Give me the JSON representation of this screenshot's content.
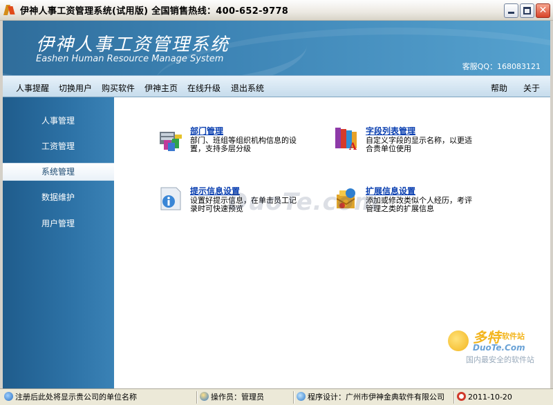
{
  "window": {
    "title": "伊神人事工资管理系统(试用版) 全国销售热线：400-652-9778"
  },
  "banner": {
    "title": "伊神人事工资管理系统",
    "subtitle": "Eashen Human Resource Manage System",
    "qq": "客服QQ：168083121"
  },
  "menu": {
    "items": [
      "人事提醒",
      "切换用户",
      "购买软件",
      "伊神主页",
      "在线升级",
      "退出系统"
    ],
    "help": "帮助",
    "about": "关于"
  },
  "sidebar": {
    "items": [
      "人事管理",
      "工资管理",
      "系统管理",
      "数据维护",
      "用户管理"
    ],
    "active_index": 2
  },
  "modules": [
    {
      "title": "部门管理",
      "desc": "部门、班组等组织机构信息的设置，支持多层分级",
      "icon": "department-icon"
    },
    {
      "title": "字段列表管理",
      "desc": "自定义字段的显示名称，以更适合贵单位使用",
      "icon": "field-list-icon"
    },
    {
      "title": "提示信息设置",
      "desc": "设置好提示信息，在单击员工记录时可快速预览",
      "icon": "tip-info-icon"
    },
    {
      "title": "扩展信息设置",
      "desc": "添加或修改类似个人经历，考评管理之类的扩展信息",
      "icon": "extension-info-icon"
    }
  ],
  "watermark": {
    "text": "DuoTe.com",
    "logo_cn": "多特",
    "logo_cn_small": "软件站",
    "logo_en": "DuoTe.Com",
    "logo_tag": "国内最安全的软件站"
  },
  "statusbar": {
    "company": "注册后此处将显示贵公司的单位名称",
    "operator": "操作员：管理员",
    "designer": "程序设计：广州市伊神金典软件有限公司",
    "date": "2011-10-20"
  },
  "colors": {
    "link": "#0a3fb0",
    "sidebar": "#2d72a6",
    "banner": "#3d84b5"
  }
}
